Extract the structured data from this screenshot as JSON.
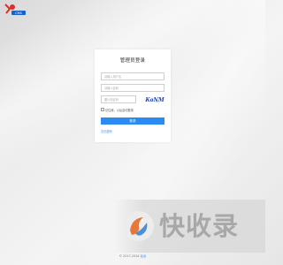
{
  "brand": {
    "logo": "site-logo",
    "logo_text": "CMS"
  },
  "login": {
    "title": "管理员登录",
    "username_placeholder": "请输入用户名",
    "password_placeholder": "请输入密码",
    "captcha_placeholder": "图片验证码",
    "captcha_text": "KaNM",
    "remember_label": "记住我，以后自动登录",
    "submit_label": "登录",
    "forgot_label": "忘记密码"
  },
  "footer": {
    "copyright": "© 2017-2024 ",
    "link_label": "后台"
  },
  "watermark": {
    "text": "快收录",
    "logo": "bird-icon"
  },
  "colors": {
    "accent": "#2a8cf0",
    "background": "#e8e8e8",
    "card": "#ffffff"
  }
}
